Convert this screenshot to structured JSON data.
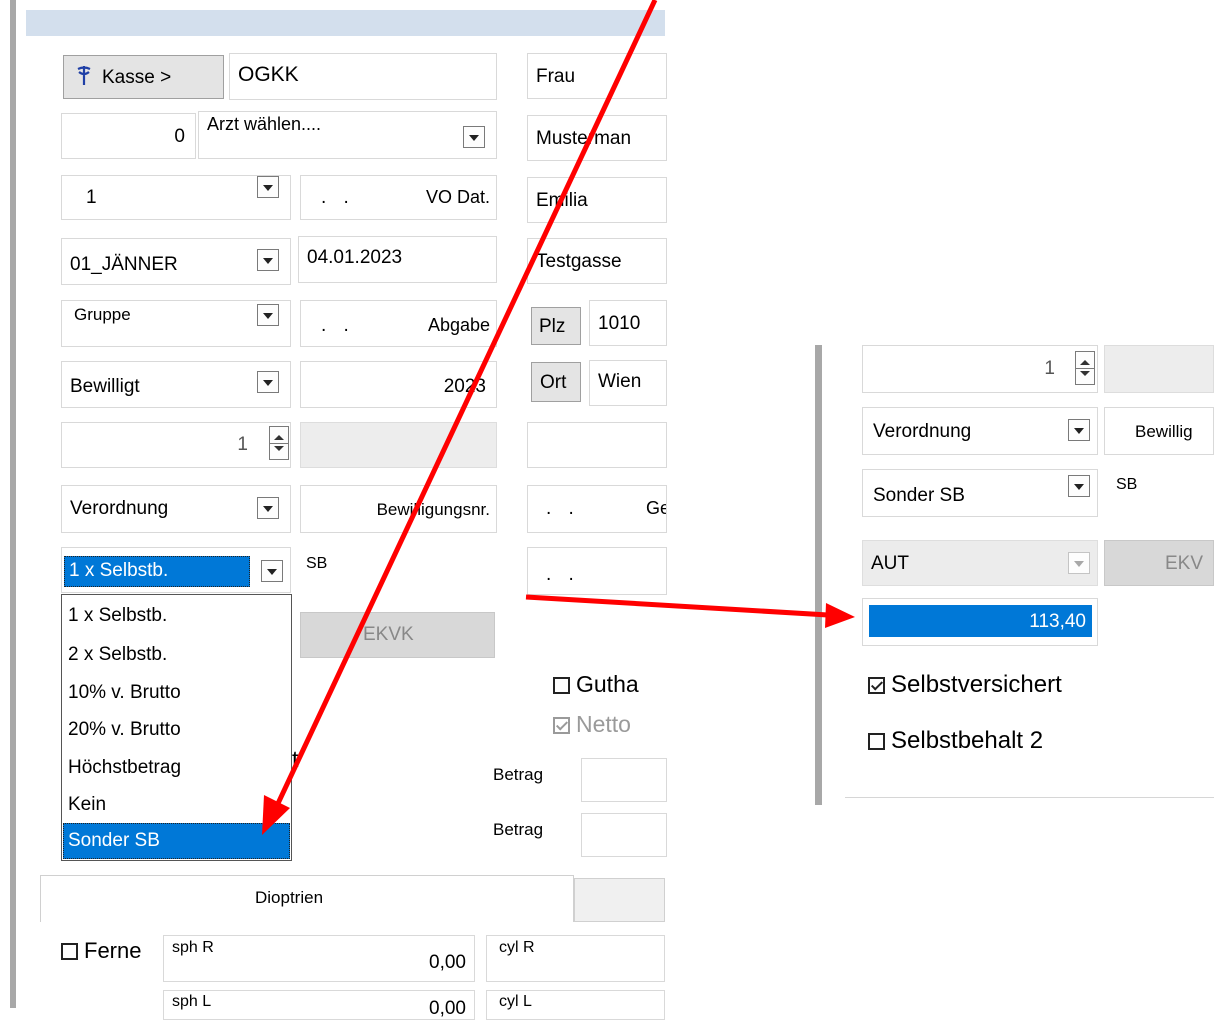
{
  "left_form": {
    "kasse_button_label": "Kasse >",
    "kasse_value": "OGKK",
    "arzt_number": "0",
    "arzt_select": "Arzt wählen....",
    "quantity_select": "1",
    "vo_date_value": ". .",
    "vo_date_label": "VO Dat.",
    "month_select": "01_JÄNNER",
    "date_value": "04.01.2023",
    "gruppe_select": "Gruppe",
    "abgabe_date_value": ". .",
    "abgabe_label": "Abgabe",
    "status_select": "Bewilligt",
    "year_value": "2023",
    "spinner_value": "1",
    "verordnung_select": "Verordnung",
    "bewilligungsnr_label": "Bewilligungsnr.",
    "sb_select": "1 x Selbstb.",
    "sb_label": "SB",
    "ekvk_label": "EKVK",
    "partial_text": "t",
    "dropdown_options": [
      "1 x Selbstb.",
      "2 x Selbstb.",
      "10% v. Brutto",
      "20% v. Brutto",
      "Höchstbetrag",
      "Kein",
      "Sonder SB"
    ],
    "tab_dioptrien": "Dioptrien",
    "ferne_label": "Ferne",
    "sph_r_label": "sph R",
    "sph_r_value": "0,00",
    "cyl_r_label": "cyl R",
    "sph_l_label": "sph L",
    "sph_l_value": "0,00",
    "cyl_l_label": "cyl L"
  },
  "middle_form": {
    "salutation": "Frau",
    "last_name": "Musterman",
    "first_name": "Emilia",
    "street": "Testgasse",
    "plz_button_label": "Plz",
    "plz_value": "1010",
    "ort_button_label": "Ort",
    "ort_value": "Wien",
    "date_field_1": ". .",
    "date_field_1_label": "Ge",
    "date_field_2": ". .",
    "guthaben_label": "Gutha",
    "netto_label": "Netto",
    "betrag_label_1": "Betrag",
    "betrag_label_2": "Betrag"
  },
  "right_panel": {
    "spinner_value": "1",
    "verordnung_select": "Verordnung",
    "bewilligung_label": "Bewillig",
    "sb_select": "Sonder SB",
    "sb_label": "SB",
    "country_select": "AUT",
    "ekvk_label": "EKV",
    "amount_value": "113,40",
    "selbstversichert_label": "Selbstversichert",
    "selbstbehalt2_label": "Selbstbehalt 2"
  },
  "colors": {
    "selection": "#0078d7",
    "annotation_arrow": "#ff0000",
    "kasse_icon": "#1f3fa6"
  }
}
